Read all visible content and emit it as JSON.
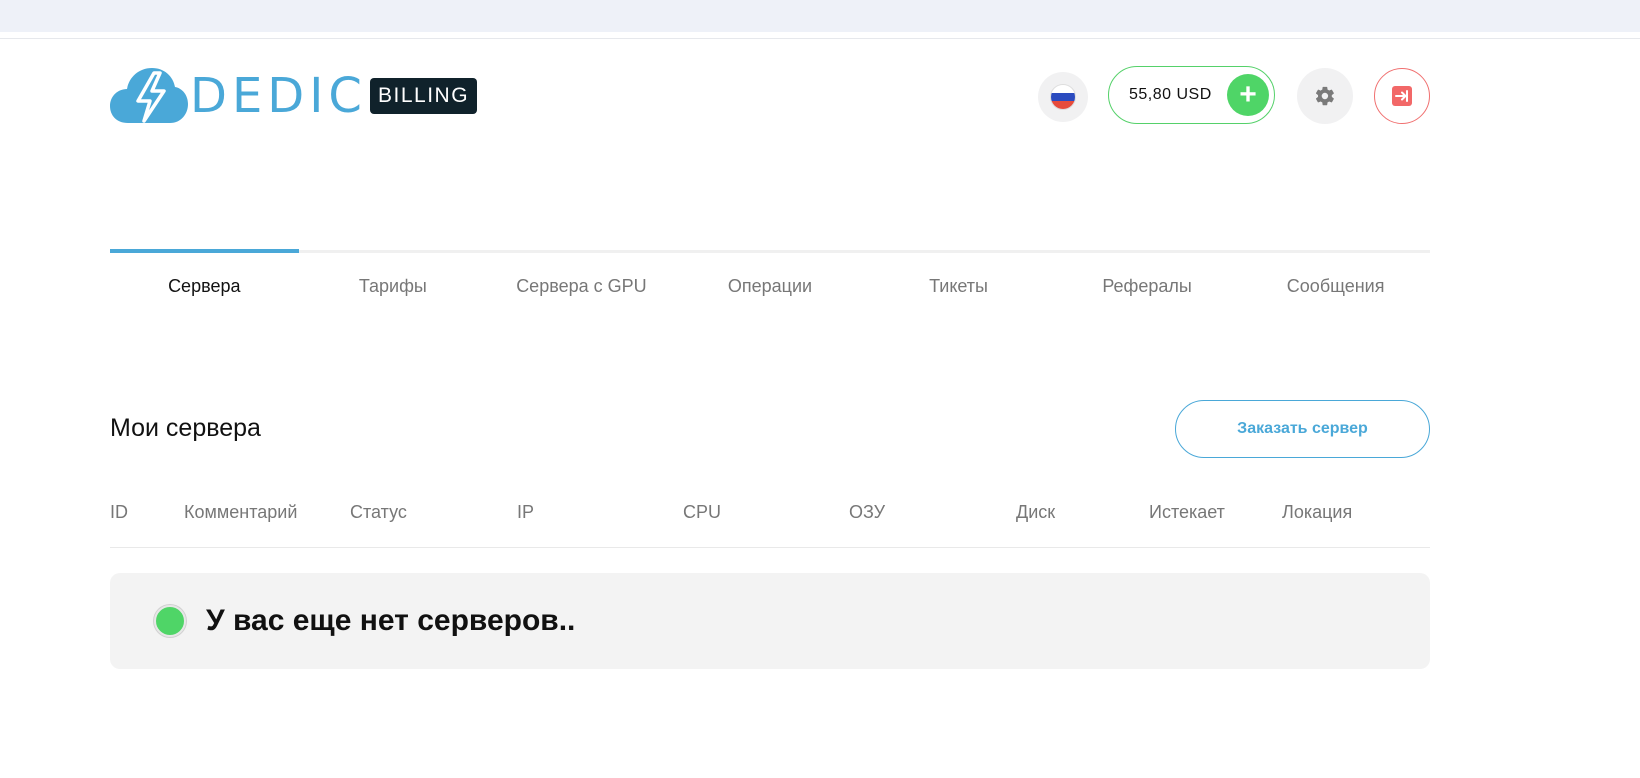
{
  "header": {
    "logo_text": "DEDIC",
    "badge": "BILLING",
    "balance": "55,80 USD",
    "add_funds_symbol": "+",
    "flag_colors": [
      "#ffffff",
      "#2b4bbf",
      "#e64b3c"
    ]
  },
  "tabs": [
    {
      "label": "Сервера",
      "active": true
    },
    {
      "label": "Тарифы",
      "active": false
    },
    {
      "label": "Сервера с GPU",
      "active": false
    },
    {
      "label": "Операции",
      "active": false
    },
    {
      "label": "Тикеты",
      "active": false
    },
    {
      "label": "Рефералы",
      "active": false
    },
    {
      "label": "Сообщения",
      "active": false
    }
  ],
  "section": {
    "title": "Мои сервера",
    "order_button": "Заказать сервер"
  },
  "table": {
    "columns": [
      "ID",
      "Комментарий",
      "Статус",
      "IP",
      "CPU",
      "ОЗУ",
      "Диск",
      "Истекает",
      "Локация"
    ]
  },
  "empty_state": {
    "message": "У вас еще нет серверов.."
  },
  "colors": {
    "accent": "#4aa8d8",
    "success": "#4fd567",
    "danger": "#f07070",
    "dark": "#10222b"
  }
}
